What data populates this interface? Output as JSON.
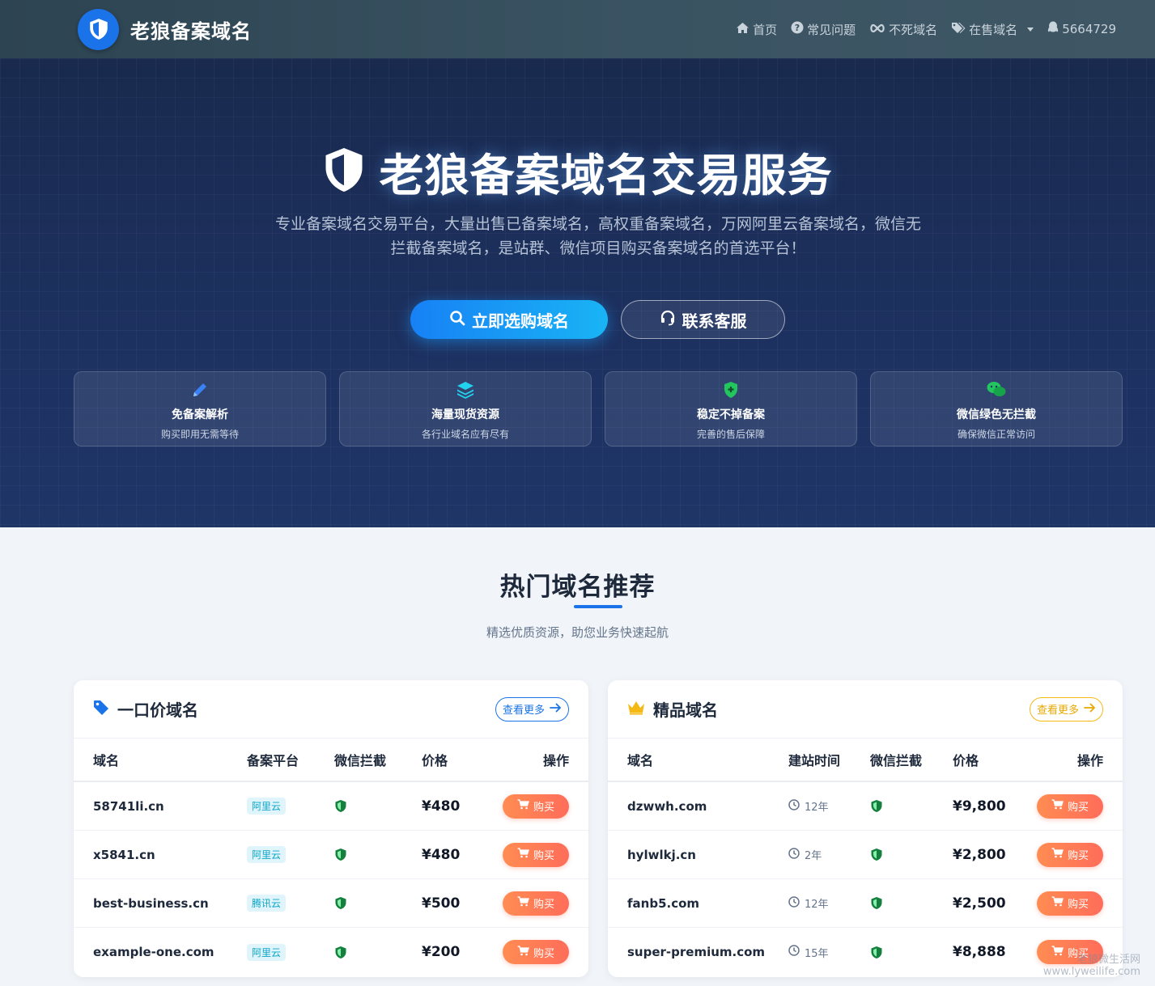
{
  "brand": {
    "name": "老狼备案域名"
  },
  "nav": [
    {
      "label": "首页",
      "icon": "home-icon"
    },
    {
      "label": "常见问题",
      "icon": "question-icon"
    },
    {
      "label": "不死域名",
      "icon": "infinity-icon"
    },
    {
      "label": "在售域名",
      "icon": "tags-icon"
    },
    {
      "label": "5664729",
      "icon": "qq-icon"
    }
  ],
  "hero": {
    "title": "老狼备案域名交易服务",
    "subtitle": "专业备案域名交易平台，大量出售已备案域名，高权重备案域名，万网阿里云备案域名，微信无拦截备案域名，是站群、微信项目购买备案域名的首选平台！",
    "primary_button": "立即选购域名",
    "secondary_button": "联系客服"
  },
  "features": [
    {
      "title": "免备案解析",
      "desc": "购买即用无需等待",
      "icon": "pencil-icon",
      "color": "#3b82f6"
    },
    {
      "title": "海量现货资源",
      "desc": "各行业域名应有尽有",
      "icon": "layers-icon",
      "color": "#22d3ee"
    },
    {
      "title": "稳定不掉备案",
      "desc": "完善的售后保障",
      "icon": "shield-plus-icon",
      "color": "#22c55e"
    },
    {
      "title": "微信绿色无拦截",
      "desc": "确保微信正常访问",
      "icon": "wechat-icon",
      "color": "#22c55e"
    }
  ],
  "section": {
    "title": "热门域名推荐",
    "subtitle": "精选优质资源，助您业务快速起航"
  },
  "fixed_price": {
    "title": "一口价域名",
    "more": "查看更多",
    "headers": [
      "域名",
      "备案平台",
      "微信拦截",
      "价格",
      "操作"
    ],
    "buy_label": "购买",
    "rows": [
      {
        "domain": "58741li.cn",
        "platform": "阿里云",
        "price": "¥480"
      },
      {
        "domain": "x5841.cn",
        "platform": "阿里云",
        "price": "¥480"
      },
      {
        "domain": "best-business.cn",
        "platform": "腾讯云",
        "price": "¥500"
      },
      {
        "domain": "example-one.com",
        "platform": "阿里云",
        "price": "¥200"
      }
    ]
  },
  "premium": {
    "title": "精品域名",
    "more": "查看更多",
    "headers": [
      "域名",
      "建站时间",
      "微信拦截",
      "价格",
      "操作"
    ],
    "buy_label": "购买",
    "rows": [
      {
        "domain": "dzwwh.com",
        "age": "12年",
        "price": "¥9,800"
      },
      {
        "domain": "hylwlkj.cn",
        "age": "2年",
        "price": "¥2,800"
      },
      {
        "domain": "fanb5.com",
        "age": "12年",
        "price": "¥2,500"
      },
      {
        "domain": "super-premium.com",
        "age": "15年",
        "price": "¥8,888"
      }
    ]
  },
  "watermark": {
    "line1": "老狼微生活网",
    "line2": "www.lyweilife.com"
  },
  "colors": {
    "accent": "#1a73e8",
    "buy": "#ff7a55",
    "shield_green": "#15803d",
    "badge": "#0ea5c7",
    "gold": "#f5b916"
  }
}
